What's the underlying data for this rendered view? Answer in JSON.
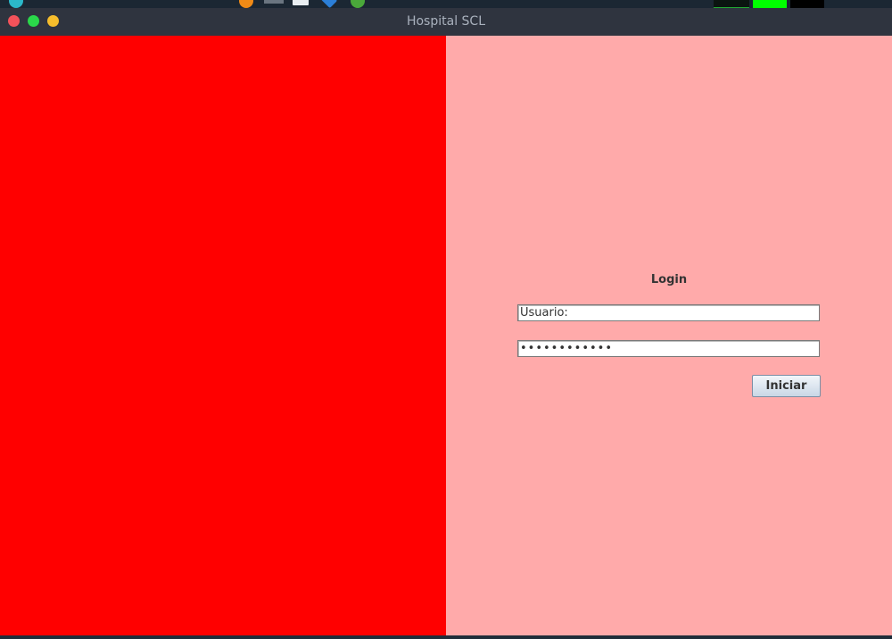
{
  "window": {
    "title": "Hospital SCL"
  },
  "left_panel": {
    "color": "#ff0000"
  },
  "right_panel": {
    "color": "#ffaaaa"
  },
  "login": {
    "heading": "Login",
    "username_value": "Usuario:",
    "password_value": "••••••••••••",
    "submit_label": "Iniciar"
  }
}
